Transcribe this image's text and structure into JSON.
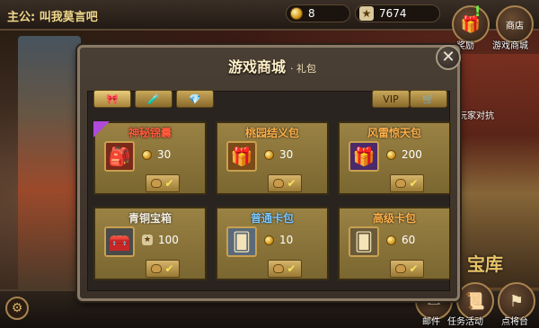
{
  "header": {
    "hero_name": "主公:  叫我莫言吧",
    "gold_value": "8",
    "yuanbao_value": "7674"
  },
  "right_menu": {
    "reward_label": "奖励",
    "shop_icon_text": "商店",
    "shop_label": "游戏商城",
    "pvp_label": "玩家对抗",
    "baoku_label": "宝库",
    "mail_label": "邮件",
    "tasks_label": "任务活动",
    "general_label": "点将台"
  },
  "modal": {
    "title": "游戏商城",
    "subtitle": "· 礼包",
    "close_glyph": "✕",
    "vip_label": "VIP"
  },
  "items": [
    {
      "name": "神秘锦囊",
      "price": "30",
      "color": "#ff5a3a"
    },
    {
      "name": "桃园结义包",
      "price": "30",
      "color": "#ffb14a"
    },
    {
      "name": "风雷惊天包",
      "price": "200",
      "color": "#ffb14a"
    },
    {
      "name": "青铜宝箱",
      "price": "100",
      "color": "#f6f0e0"
    },
    {
      "name": "普通卡包",
      "price": "10",
      "color": "#7ac8ff"
    },
    {
      "name": "高级卡包",
      "price": "60",
      "color": "#ffb14a"
    }
  ]
}
